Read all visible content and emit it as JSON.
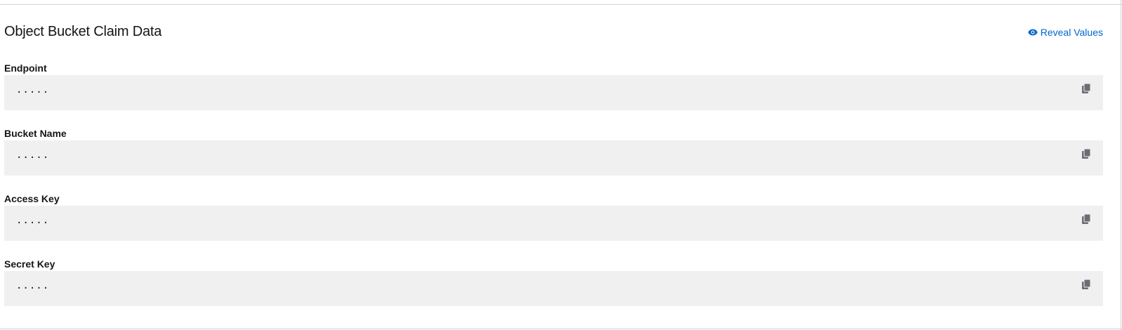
{
  "section": {
    "title": "Object Bucket Claim Data",
    "reveal_label": "Reveal Values",
    "reveal_icon": "eye-icon"
  },
  "fields": [
    {
      "label": "Endpoint",
      "value": ".....",
      "copy_icon": "copy-icon"
    },
    {
      "label": "Bucket Name",
      "value": ".....",
      "copy_icon": "copy-icon"
    },
    {
      "label": "Access Key",
      "value": ".....",
      "copy_icon": "copy-icon"
    },
    {
      "label": "Secret Key",
      "value": ".....",
      "copy_icon": "copy-icon"
    }
  ],
  "colors": {
    "link": "#0066cc",
    "field_background": "#f0f0f0",
    "icon": "#6a6e73"
  }
}
